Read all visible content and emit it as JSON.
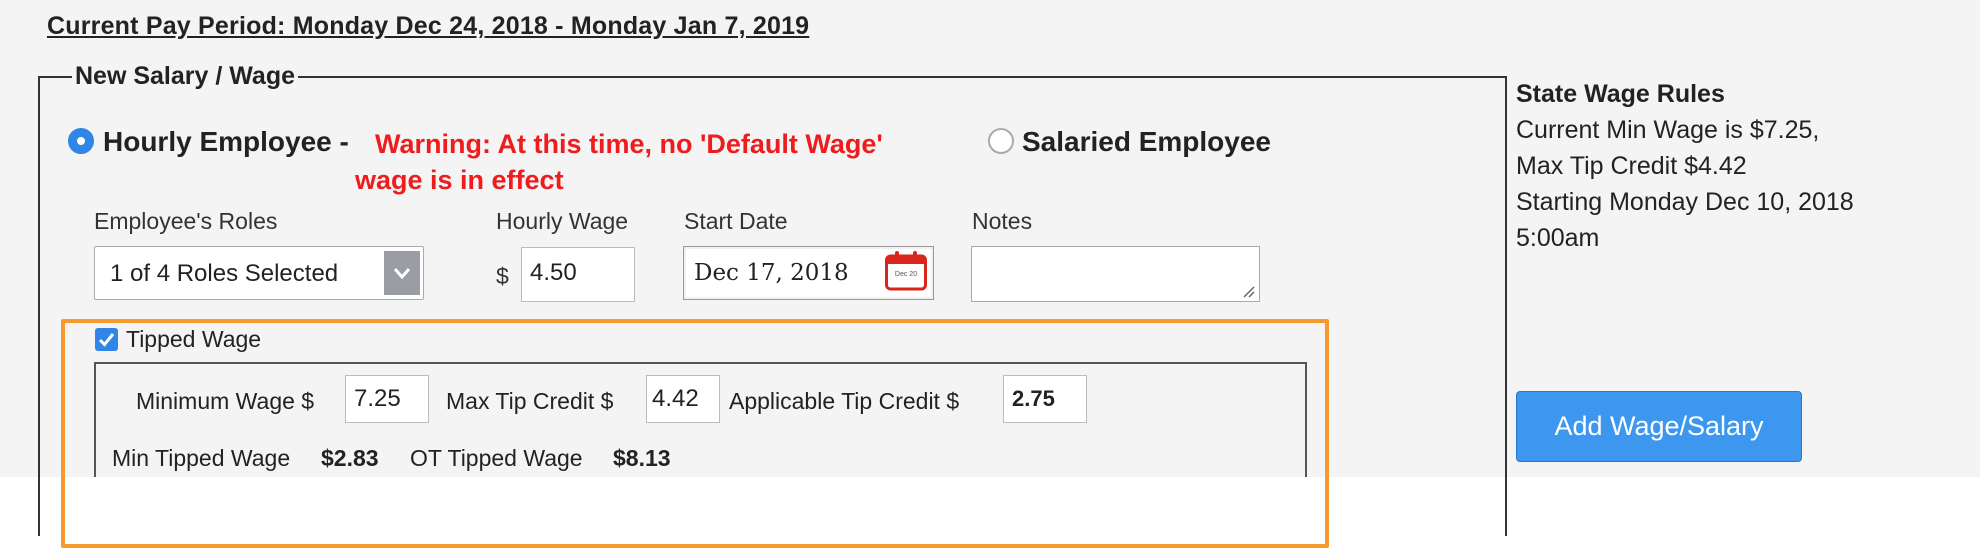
{
  "pay_period": {
    "title": "Current Pay Period: Monday Dec 24, 2018 - Monday Jan 7, 2019"
  },
  "wage_form": {
    "legend": "New Salary / Wage",
    "hourly": {
      "label": "Hourly Employee -",
      "selected": true
    },
    "warning": "Warning: At this time, no 'Default Wage' wage is in effect",
    "salaried": {
      "label": "Salaried Employee",
      "selected": false
    },
    "roles": {
      "label": "Employee's Roles",
      "value": "1 of 4 Roles Selected"
    },
    "hourly_wage": {
      "label": "Hourly Wage",
      "currency": "$",
      "value": "4.50"
    },
    "start_date": {
      "label": "Start Date",
      "value": "Dec 17, 2018",
      "calendar_icon_text": "Dec 20"
    },
    "notes": {
      "label": "Notes",
      "value": ""
    },
    "tipped": {
      "checkbox_label": "Tipped Wage",
      "checked": true,
      "min_wage_label": "Minimum Wage $",
      "min_wage_value": "7.25",
      "max_tip_label": "Max Tip Credit $",
      "max_tip_value": "4.42",
      "applicable_label": "Applicable Tip Credit $",
      "applicable_value": "2.75",
      "min_tipped_label": "Min Tipped Wage",
      "min_tipped_value": "$2.83",
      "ot_tipped_label": "OT Tipped Wage",
      "ot_tipped_value": "$8.13"
    }
  },
  "state_rules": {
    "title": "State Wage Rules",
    "lines": [
      "Current Min Wage is $7.25,",
      "Max Tip Credit $4.42",
      "Starting Monday Dec 10, 2018",
      "5:00am"
    ]
  },
  "actions": {
    "add_button": "Add Wage/Salary"
  },
  "colors": {
    "accent": "#2f86e6",
    "warning": "#ee1c1c",
    "highlight": "#f79a2e",
    "button": "#3d97ee",
    "calendar": "#d9261c"
  },
  "icons": {
    "dropdown": "chevron-down-icon",
    "calendar": "calendar-icon",
    "checkbox": "checkmark-icon",
    "resize": "resize-handle-icon"
  }
}
